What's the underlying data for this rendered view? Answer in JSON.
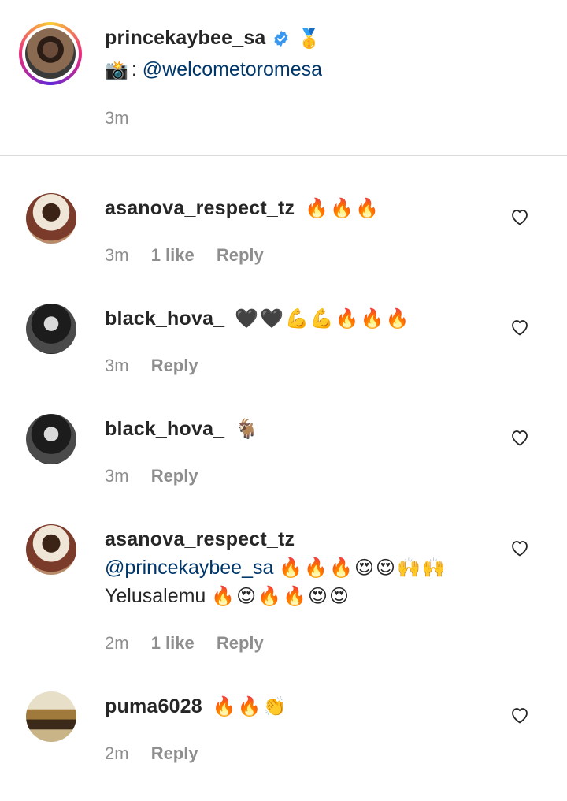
{
  "caption": {
    "username": "princekaybee_sa",
    "medal_emoji": "🥇",
    "camera_emoji": "📸",
    "separator": ":",
    "mention": "@welcometoromesa",
    "time": "3m"
  },
  "comments": [
    {
      "username": "asanova_respect_tz",
      "text": "🔥🔥🔥",
      "time": "3m",
      "likes": "1 like",
      "reply": "Reply"
    },
    {
      "username": "black_hova_",
      "text": "🖤🖤💪💪🔥🔥🔥",
      "time": "3m",
      "reply": "Reply"
    },
    {
      "username": "black_hova_",
      "text": "🐐",
      "time": "3m",
      "reply": "Reply"
    },
    {
      "username": "asanova_respect_tz",
      "mention": "@princekaybee_sa",
      "line2_emoji": "🔥🔥🔥😍😍🙌🙌",
      "line3_text": "Yelusalemu",
      "line3_emoji": "🔥😍🔥🔥😍😍",
      "time": "2m",
      "likes": "1 like",
      "reply": "Reply"
    },
    {
      "username": "puma6028",
      "text": "🔥🔥👏",
      "time": "2m",
      "reply": "Reply"
    }
  ],
  "icons": {
    "verified": "verified-badge-icon",
    "heart": "heart-outline-icon"
  },
  "colors": {
    "verified_blue": "#3897f0",
    "mention": "#00376b",
    "meta_grey": "#8e8e8e"
  }
}
